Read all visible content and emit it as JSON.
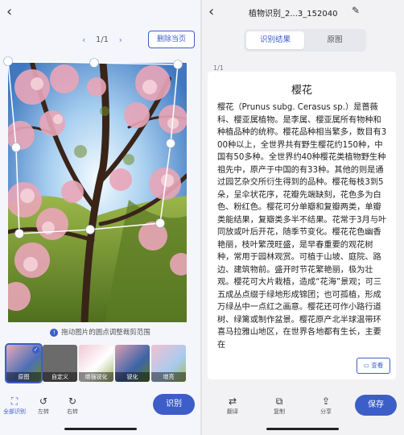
{
  "left": {
    "back_icon": "chevron-left-icon",
    "pager": {
      "prev_icon": "chevron-left-icon",
      "current": "1/1",
      "next_icon": "chevron-right-icon"
    },
    "delete_label": "删除当页",
    "hint_icon": "info-icon",
    "hint_text": "拖动图片的圆点调整裁剪范围",
    "filters": [
      {
        "label": "原图",
        "selected": true
      },
      {
        "label": "自定义",
        "selected": false
      },
      {
        "label": "增强锐化",
        "selected": false
      },
      {
        "label": "锐化",
        "selected": false
      },
      {
        "label": "增亮",
        "selected": false
      }
    ],
    "tools": [
      {
        "icon": "crop-full-icon",
        "label": "全部识别"
      },
      {
        "icon": "rotate-left-icon",
        "label": "左转"
      },
      {
        "icon": "rotate-right-icon",
        "label": "右转"
      }
    ],
    "next_label": "识别"
  },
  "right": {
    "back_icon": "chevron-left-icon",
    "title": "植物识别_2...3_152040",
    "edit_icon": "pencil-icon",
    "tabs": [
      {
        "label": "识别结果",
        "active": true
      },
      {
        "label": "原图",
        "active": false
      }
    ],
    "page_num": "1/1",
    "card": {
      "heading": "樱花",
      "body": "樱花（Prunus subg. Cerasus sp.）是蔷薇科、樱亚属植物。是李属、樱亚属所有物种和种植品种的统称。樱花品种相当繁多，数目有300种以上，全世界共有野生樱花约150种，中国有50多种。全世界约40种樱花类植物野生种祖先中，原产于中国的有33种。其他的则是通过园艺杂交所衍生得到的品种。樱花每枝3到5朵，呈伞状花序，花瓣先端缺刻，花色多为白色、粉红色。樱花可分单瓣和复瓣两类，单瓣类能结果，复瓣类多半不结果。花常于3月与叶同放或叶后开花，随季节变化。樱花花色幽香艳丽，枝叶繁茂旺盛，是早春重要的观花树种，常用于园林观赏。可植于山坡、庭院、路边、建筑物前。盛开时节花繁艳丽，极为壮观。樱花可大片栽植，造成“花海”景观；可三五成丛点缀于绿地形成锦团；也可孤植，形成万绿丛中一点红之画意。樱花还可作小路行道树、绿篱或制作盆景。樱花原产北半球温带环喜马拉雅山地区，在世界各地都有生长，主要在",
      "copy_icon": "book-icon",
      "copy_label": "查看"
    },
    "tools": [
      {
        "icon": "translate-icon",
        "label": "翻译"
      },
      {
        "icon": "copy-icon",
        "label": "复制"
      },
      {
        "icon": "share-icon",
        "label": "分享"
      }
    ],
    "save_label": "保存"
  },
  "colors": {
    "accent": "#3d5ec8",
    "panel_bg": "#f4f6fb",
    "card_bg": "#ffffff"
  }
}
